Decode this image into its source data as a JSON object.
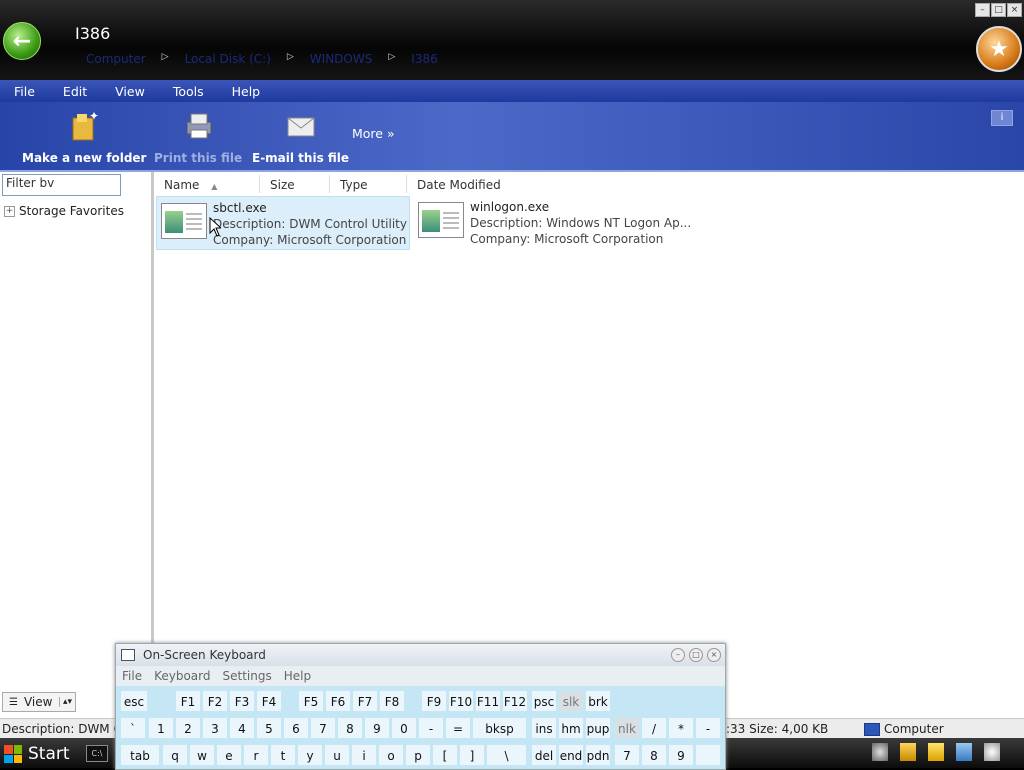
{
  "window": {
    "title": "I386",
    "breadcrumbs": [
      "Computer",
      "Local Disk (C:)",
      "WINDOWS",
      "I386"
    ]
  },
  "menu": [
    "File",
    "Edit",
    "View",
    "Tools",
    "Help"
  ],
  "toolbar": {
    "new_folder": "Make a new folder",
    "print": "Print this file",
    "email": "E-mail this file",
    "more": "More"
  },
  "sidebar": {
    "filter_value": "Filter bv",
    "favorites": "Storage Favorites",
    "view_label": "View"
  },
  "columns": [
    "Name",
    "Size",
    "Type",
    "Date Modified"
  ],
  "files": [
    {
      "name": "sbctl.exe",
      "description": "Description: DWM Control Utility",
      "company": "Company: Microsoft Corporation"
    },
    {
      "name": "winlogon.exe",
      "description": "Description: Windows NT Logon Ap...",
      "company": "Company: Microsoft Corporation"
    }
  ],
  "status": {
    "left": "Description: DWM Co",
    "mid": ":33 Size: 4,00 KB",
    "location": "Computer"
  },
  "taskbar": {
    "start": "Start",
    "cmd": "C:\\"
  },
  "osk": {
    "title": "On-Screen Keyboard",
    "menu": [
      "File",
      "Keyboard",
      "Settings",
      "Help"
    ]
  }
}
